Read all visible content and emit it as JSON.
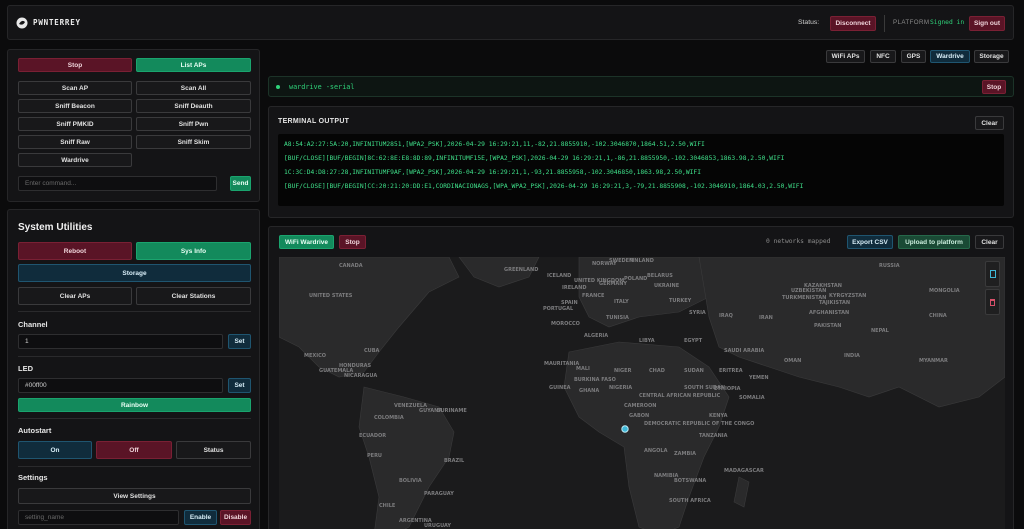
{
  "header": {
    "brand": "PWNTERREY",
    "status_label": "Status:",
    "disconnect": "Disconnect",
    "platform_label": "PLATFORM",
    "signed_in": "Signed in",
    "sign_out": "Sign out"
  },
  "wifi_panel": {
    "stop": "Stop",
    "list_aps": "List APs",
    "scan_ap": "Scan AP",
    "scan_all": "Scan All",
    "sniff_beacon": "Sniff Beacon",
    "sniff_deauth": "Sniff Deauth",
    "sniff_pmkid": "Sniff PMKID",
    "sniff_pwn": "Sniff Pwn",
    "sniff_raw": "Sniff Raw",
    "sniff_skim": "Sniff Skim",
    "wardrive": "Wardrive",
    "command_placeholder": "Enter command...",
    "send": "Send"
  },
  "system": {
    "title": "System Utilities",
    "reboot": "Reboot",
    "sys_info": "Sys Info",
    "storage": "Storage",
    "clear_aps": "Clear APs",
    "clear_stations": "Clear Stations",
    "channel_label": "Channel",
    "channel_value": "1",
    "set": "Set",
    "led_label": "LED",
    "led_value": "#00ff00",
    "rainbow": "Rainbow",
    "autostart_label": "Autostart",
    "on": "On",
    "off": "Off",
    "status": "Status",
    "settings_label": "Settings",
    "view_settings": "View Settings",
    "setting_placeholder": "setting_name",
    "enable": "Enable",
    "disable": "Disable"
  },
  "tabs": [
    "WiFi APs",
    "NFC",
    "GPS",
    "Wardrive",
    "Storage"
  ],
  "active_tab": "Wardrive",
  "command_bar": {
    "text": "wardrive -serial",
    "stop": "Stop"
  },
  "terminal": {
    "title": "TERMINAL OUTPUT",
    "clear": "Clear",
    "lines": [
      "A8:54:A2:27:5A:20,INFINITUM2851,[WPA2_PSK],2026-04-29 16:29:21,11,-82,21.8855910,-102.3046870,1864.51,2.50,WIFI",
      "[BUF/CLOSE][BUF/BEGIN]8C:62:8E:E8:8D:89,INFINITUMF15E,[WPA2_PSK],2026-04-29 16:29:21,1,-86,21.8855950,-102.3046853,1863.98,2.50,WIFI",
      "1C:3C:D4:D8:27:28,INFINITUMF9AF,[WPA2_PSK],2026-04-29 16:29:21,1,-93,21.8855958,-102.3046850,1863.98,2.50,WIFI",
      "[BUF/CLOSE][BUF/BEGIN]CC:20:21:20:DD:E1,CORDINACIONAGS,[WPA_WPA2_PSK],2026-04-29 16:29:21,3,-79,21.8855908,-102.3046910,1864.03,2.50,WIFI"
    ]
  },
  "map": {
    "wifi_wardrive": "WiFi Wardrive",
    "stop": "Stop",
    "networks_mapped": "0 networks mapped",
    "export_csv": "Export CSV",
    "upload": "Upload to platform",
    "clear": "Clear",
    "labels": {
      "greenland": "GREENLAND",
      "iceland": "ICELAND",
      "russia": "RUSSIA",
      "sweden": "SWEDEN",
      "finland": "FINLAND",
      "norway": "NORWAY",
      "uk": "UNITED KINGDOM",
      "ireland": "IRELAND",
      "belarus": "BELARUS",
      "poland": "POLAND",
      "germany": "GERMANY",
      "ukraine": "UKRAINE",
      "kazakhstan": "KAZAKHSTAN",
      "mongolia": "MONGOLIA",
      "france": "FRANCE",
      "italy": "ITALY",
      "spain": "SPAIN",
      "portugal": "PORTUGAL",
      "turkey": "TURKEY",
      "uzbekistan": "UZBEKISTAN",
      "turkmenistan": "TURKMENISTAN",
      "kyrgyzstan": "KYRGYZSTAN",
      "tajikistan": "TAJIKISTAN",
      "china": "CHINA",
      "afghanistan": "AFGHANISTAN",
      "syria": "SYRIA",
      "iraq": "IRAQ",
      "iran": "IRAN",
      "pakistan": "PAKISTAN",
      "nepal": "NEPAL",
      "tunisia": "TUNISIA",
      "morocco": "MOROCCO",
      "algeria": "ALGERIA",
      "libya": "LIBYA",
      "egypt": "EGYPT",
      "saudi_arabia": "SAUDI ARABIA",
      "oman": "OMAN",
      "india": "INDIA",
      "myanmar": "MYANMAR",
      "mauritania": "MAURITANIA",
      "mali": "MALI",
      "niger": "NIGER",
      "chad": "CHAD",
      "sudan": "SUDAN",
      "eritrea": "ERITREA",
      "yemen": "YEMEN",
      "burkina_faso": "BURKINA FASO",
      "guinea": "GUINEA",
      "ghana": "GHANA",
      "nigeria": "NIGERIA",
      "south_sudan": "SOUTH SUDAN",
      "ethiopia": "ETHIOPIA",
      "somalia": "SOMALIA",
      "central_african_republic": "CENTRAL AFRICAN REPUBLIC",
      "cameroon": "CAMEROON",
      "gabon": "GABON",
      "kenya": "KENYA",
      "dr_congo": "DEMOCRATIC REPUBLIC OF THE CONGO",
      "tanzania": "TANZANIA",
      "angola": "ANGOLA",
      "zambia": "ZAMBIA",
      "namibia": "NAMIBIA",
      "botswana": "BOTSWANA",
      "south_africa": "SOUTH AFRICA",
      "madagascar": "MADAGASCAR",
      "canada": "CANADA",
      "united_states": "UNITED STATES",
      "mexico": "MEXICO",
      "cuba": "CUBA",
      "venezuela": "VENEZUELA",
      "colombia": "COLOMBIA",
      "ecuador": "ECUADOR",
      "peru": "PERU",
      "brazil": "BRAZIL",
      "bolivia": "BOLIVIA",
      "paraguay": "PARAGUAY",
      "chile": "CHILE",
      "argentina": "ARGENTINA",
      "uruguay": "URUGUAY",
      "guyana": "GUYANA",
      "suriname": "SURINAME",
      "guatemala": "GUATEMALA",
      "honduras": "HONDURAS",
      "nicaragua": "NICARAGUA"
    }
  }
}
